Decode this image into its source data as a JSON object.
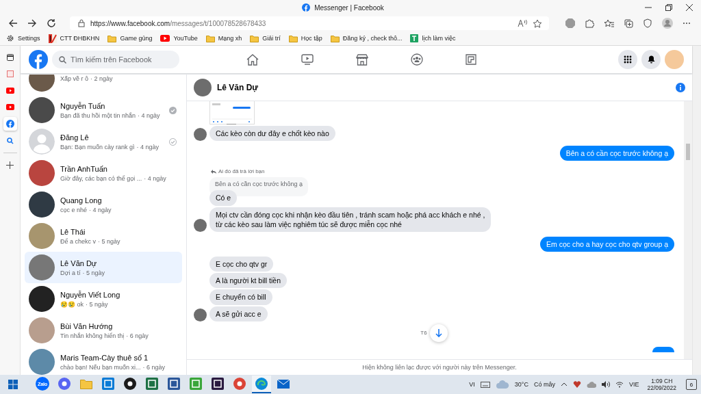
{
  "browser": {
    "tab_title": "Messenger | Facebook",
    "url_host": "https://www.facebook.com",
    "url_path": "/messages/t/100078528678433"
  },
  "bookmarks": [
    {
      "kind": "gear",
      "label": "Settings"
    },
    {
      "kind": "app",
      "label": "CTT ĐHBKHN"
    },
    {
      "kind": "folder",
      "label": "Game gủng"
    },
    {
      "kind": "youtube",
      "label": "YouTube"
    },
    {
      "kind": "folder",
      "label": "Mạng xh"
    },
    {
      "kind": "folder",
      "label": "Giải trí"
    },
    {
      "kind": "folder",
      "label": "Học tập"
    },
    {
      "kind": "folder",
      "label": "Đăng ký , check thô..."
    },
    {
      "kind": "sheet",
      "label": "lịch làm việc"
    }
  ],
  "edge_sidebar": [
    {
      "kind": "tabs",
      "selected": false
    },
    {
      "kind": "app",
      "selected": false
    },
    {
      "kind": "youtube",
      "selected": false
    },
    {
      "kind": "youtube",
      "selected": false
    },
    {
      "kind": "facebook",
      "selected": true
    },
    {
      "kind": "search",
      "selected": false
    },
    {
      "kind": "add",
      "selected": false
    }
  ],
  "facebook": {
    "search": {
      "placeholder": "Tìm kiếm trên Facebook"
    }
  },
  "conversations": [
    {
      "preview": "Xấp về r ô",
      "time": "· 2 ngày",
      "selected": false,
      "default_avatar": false,
      "delivered": false,
      "sent": false
    },
    {
      "name": "Nguyễn Tuấn",
      "preview": "Bạn đã thu hồi một tin nhắn",
      "time": "· 4 ngày",
      "selected": false,
      "default_avatar": false,
      "delivered": true,
      "sent": false
    },
    {
      "name": "Đăng Lê",
      "preview": "Bạn: Bạn muốn cày rank gì",
      "time": "· 4 ngày",
      "selected": false,
      "default_avatar": true,
      "delivered": false,
      "sent": true
    },
    {
      "name": "Trần AnhTuấn",
      "preview": "Giờ đây, các bạn có thể gọi ...",
      "time": "· 4 ngày",
      "selected": false,
      "default_avatar": false,
      "delivered": false,
      "sent": false
    },
    {
      "name": "Quang Long",
      "preview": "cọc e nhé",
      "time": "· 4 ngày",
      "selected": false,
      "default_avatar": false,
      "delivered": false,
      "sent": false
    },
    {
      "name": "Lê Thái",
      "preview": "Để a chekc v",
      "time": "· 5 ngày",
      "selected": false,
      "default_avatar": false,
      "delivered": false,
      "sent": false
    },
    {
      "name": "Lê Văn Dự",
      "preview": "Dợi a tí",
      "time": "· 5 ngày",
      "selected": true,
      "default_avatar": false,
      "delivered": false,
      "sent": false
    },
    {
      "name": "Nguyễn Viết Long",
      "preview": "😢😢 ok",
      "time": "· 5 ngày",
      "selected": false,
      "default_avatar": false,
      "delivered": false,
      "sent": false
    },
    {
      "name": "Bùi Văn Hướng",
      "preview": "Tin nhắn không hiển thị",
      "time": "· 6 ngày",
      "selected": false,
      "default_avatar": false,
      "delivered": false,
      "sent": false
    },
    {
      "name": "Maris Team-Cày thuê số 1",
      "preview": "chào bạn! Nếu bạn muốn xi...",
      "time": "· 6 ngày",
      "selected": false,
      "default_avatar": false,
      "delivered": false,
      "sent": false
    }
  ],
  "chat": {
    "name": "Lê Văn Dự",
    "messages": [
      {
        "kind": "image",
        "outgoing": false,
        "avatar": false
      },
      {
        "kind": "text",
        "outgoing": false,
        "avatar": true,
        "text": "Các kèo còn dư đây e chốt kèo nào"
      },
      {
        "kind": "text",
        "outgoing": true,
        "avatar": false,
        "text": "Bên a có cần cọc trước không ạ"
      },
      {
        "kind": "reply",
        "outgoing": false,
        "avatar": false,
        "note": "Ai đó đã trả lời bạn",
        "quoted": "Bên a có cần cọc trước không ạ",
        "text": "Có e"
      },
      {
        "kind": "text",
        "outgoing": false,
        "avatar": true,
        "text": "Mọi ctv cần đóng cọc khi nhận kèo đầu tiên , tránh scam hoặc phá acc khách e nhé ,\ntừ các kèo sau làm việc nghiêm túc sẽ được miễn cọc nhé"
      },
      {
        "kind": "text",
        "outgoing": true,
        "avatar": false,
        "text": "Em cọc cho a hay cọc cho qtv group ạ"
      },
      {
        "kind": "text",
        "outgoing": false,
        "avatar": false,
        "text": "E cọc cho qtv gr"
      },
      {
        "kind": "text",
        "outgoing": false,
        "avatar": false,
        "text": "A là người kt bill tiền"
      },
      {
        "kind": "text",
        "outgoing": false,
        "avatar": false,
        "text": "E chuyển có bill"
      },
      {
        "kind": "text",
        "outgoing": false,
        "avatar": true,
        "text": "A sẽ gửi acc e"
      },
      {
        "kind": "date",
        "text": "T6"
      },
      {
        "kind": "cut",
        "outgoing": true,
        "avatar": false
      }
    ],
    "footer": "Hiện không liên lạc được với người này trên Messenger."
  },
  "taskbar": {
    "apps": [
      {
        "kind": "zalo",
        "label": "Zalo",
        "selected": false
      },
      {
        "kind": "discord",
        "selected": false
      },
      {
        "kind": "folder",
        "selected": false
      },
      {
        "kind": "store",
        "selected": false
      },
      {
        "kind": "dell",
        "selected": false
      },
      {
        "kind": "excel",
        "selected": false
      },
      {
        "kind": "word",
        "selected": false
      },
      {
        "kind": "green",
        "selected": false
      },
      {
        "kind": "nox",
        "selected": false
      },
      {
        "kind": "chrome",
        "selected": false
      },
      {
        "kind": "edge",
        "selected": true
      },
      {
        "kind": "mail",
        "selected": false
      }
    ],
    "ime": "VI",
    "temperature": "30°C",
    "weather": "Có mây",
    "language": "VIE",
    "time": "1:09 CH",
    "date": "22/09/2022",
    "notifications": "6"
  }
}
